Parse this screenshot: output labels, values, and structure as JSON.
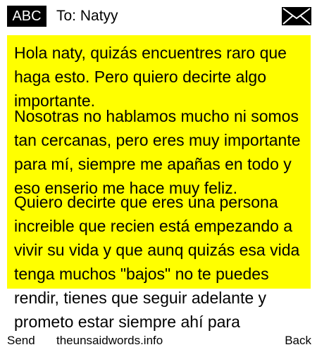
{
  "header": {
    "input_mode": "ABC",
    "to_label": "To:",
    "recipient": "Natyy",
    "icon": "envelope-icon"
  },
  "message": {
    "paragraphs": [
      "Hola naty, quizás encuentres raro que haga esto. Pero quiero decirte algo importante.",
      "Nosotras no hablamos mucho ni somos tan cercanas, pero eres muy importante para mí, siempre me apañas en todo y eso enserio me hace muy feliz.",
      "Quiero decirte que eres una persona increible que recien está empezando a vivir su vida y que aunq quizás esa vida tenga muchos \"bajos\" no te puedes rendir, tienes que seguir adelante y prometo estar siempre ahí para"
    ],
    "highlight_color": "#ffff00"
  },
  "softkeys": {
    "left": "Send",
    "center": "theunsaidwords.info",
    "right": "Back"
  }
}
